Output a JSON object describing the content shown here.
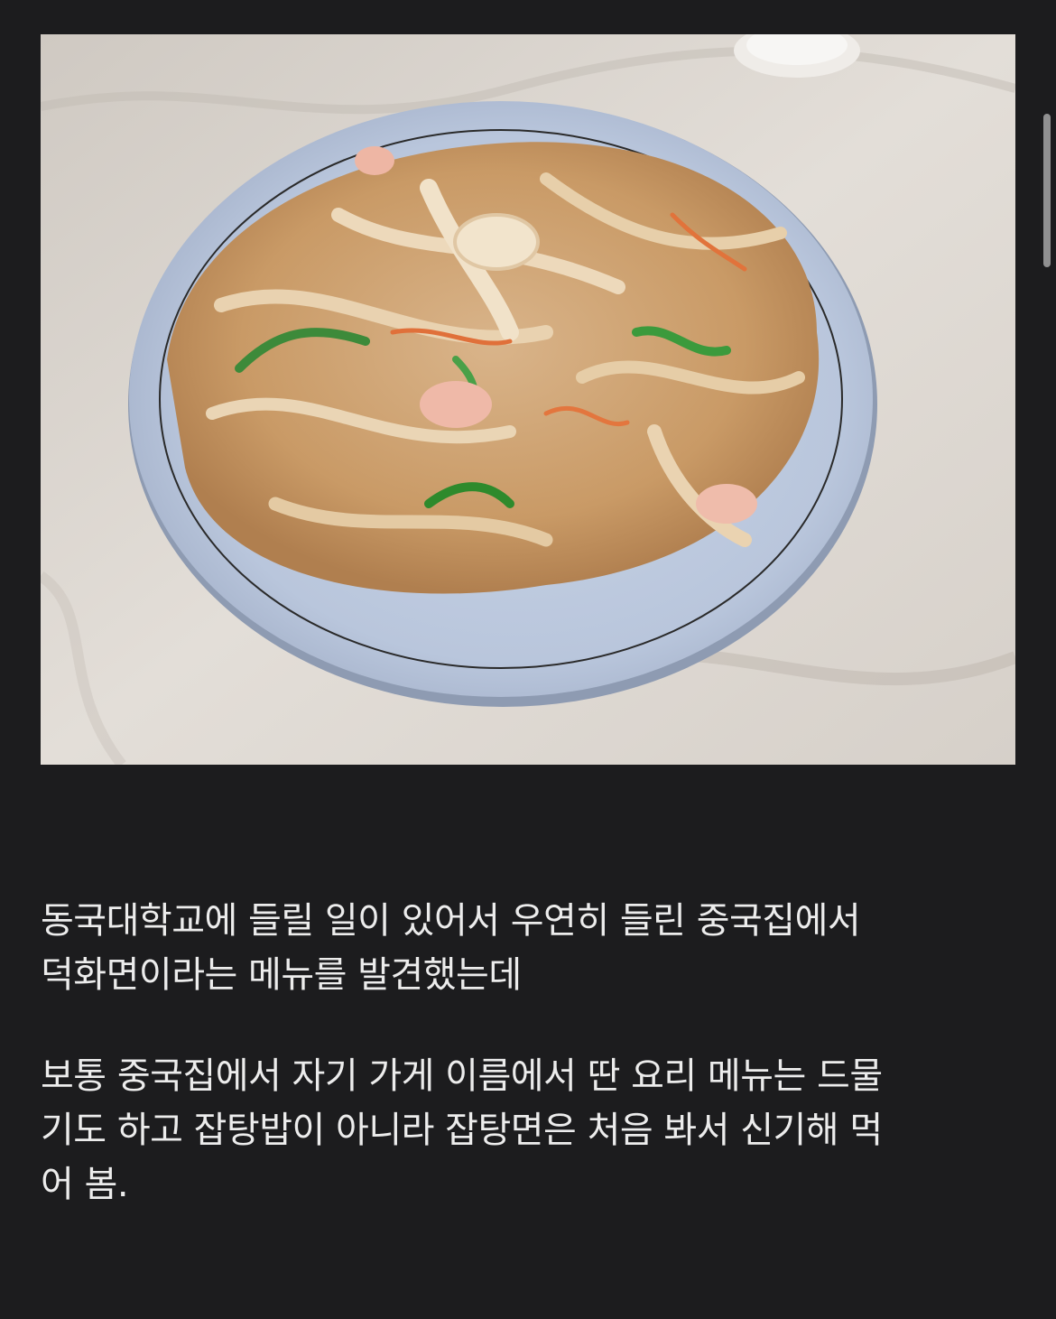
{
  "photo": {
    "subject": "food-photo"
  },
  "post": {
    "paragraphs": [
      "동국대학교에 들릴 일이 있어서 우연히 들린 중국집에서\n덕화면이라는 메뉴를 발견했는데",
      "보통 중국집에서 자기 가게 이름에서 딴 요리 메뉴는 드물\n기도 하고 잡탕밥이 아니라 잡탕면은 처음 봐서 신기해 먹\n어 봄."
    ]
  },
  "colors": {
    "background": "#1c1c1e",
    "text": "#ececec",
    "scrollbar": "#a4a4a6"
  }
}
